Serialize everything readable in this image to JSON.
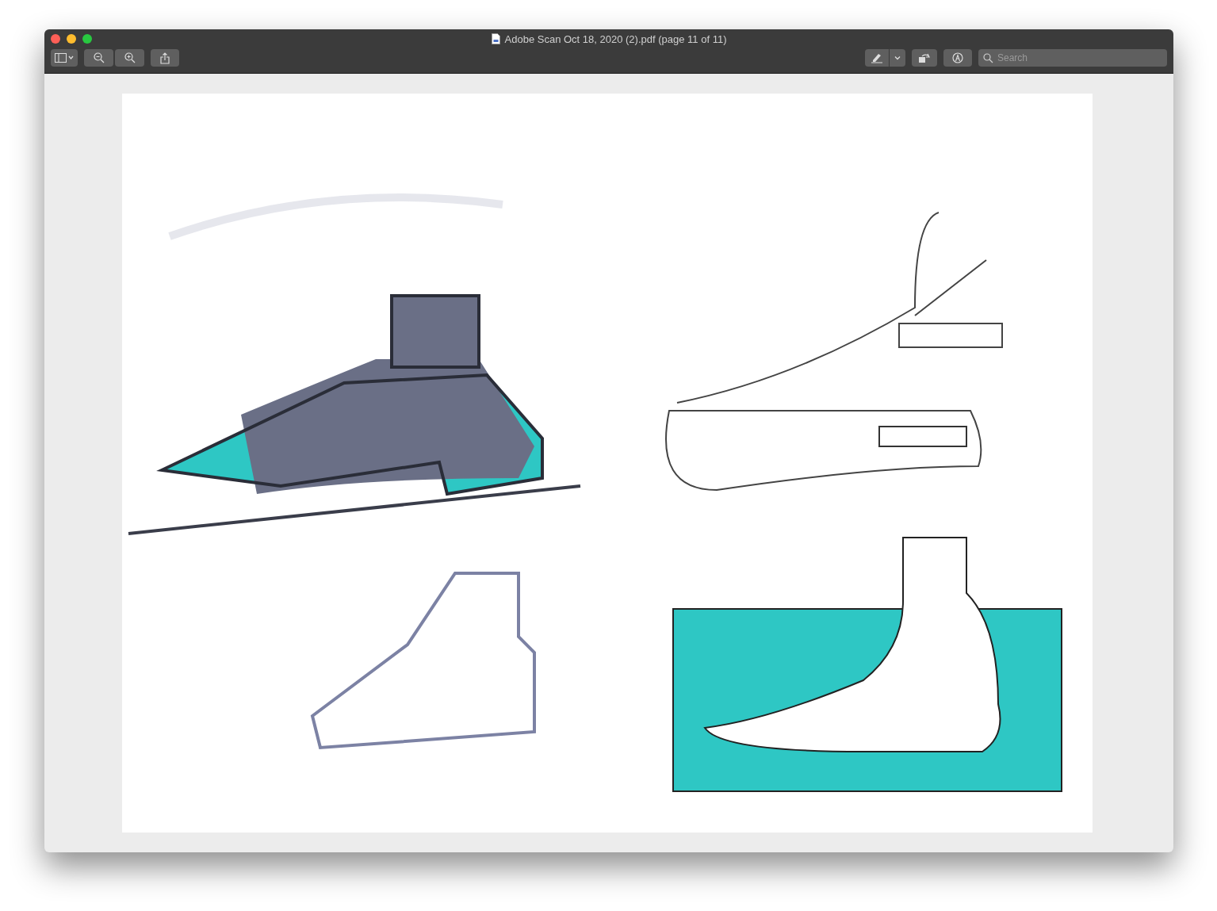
{
  "window": {
    "title": "Adobe Scan Oct 18, 2020 (2).pdf (page 11 of 11)"
  },
  "toolbar": {
    "search": {
      "placeholder": "Search"
    }
  }
}
